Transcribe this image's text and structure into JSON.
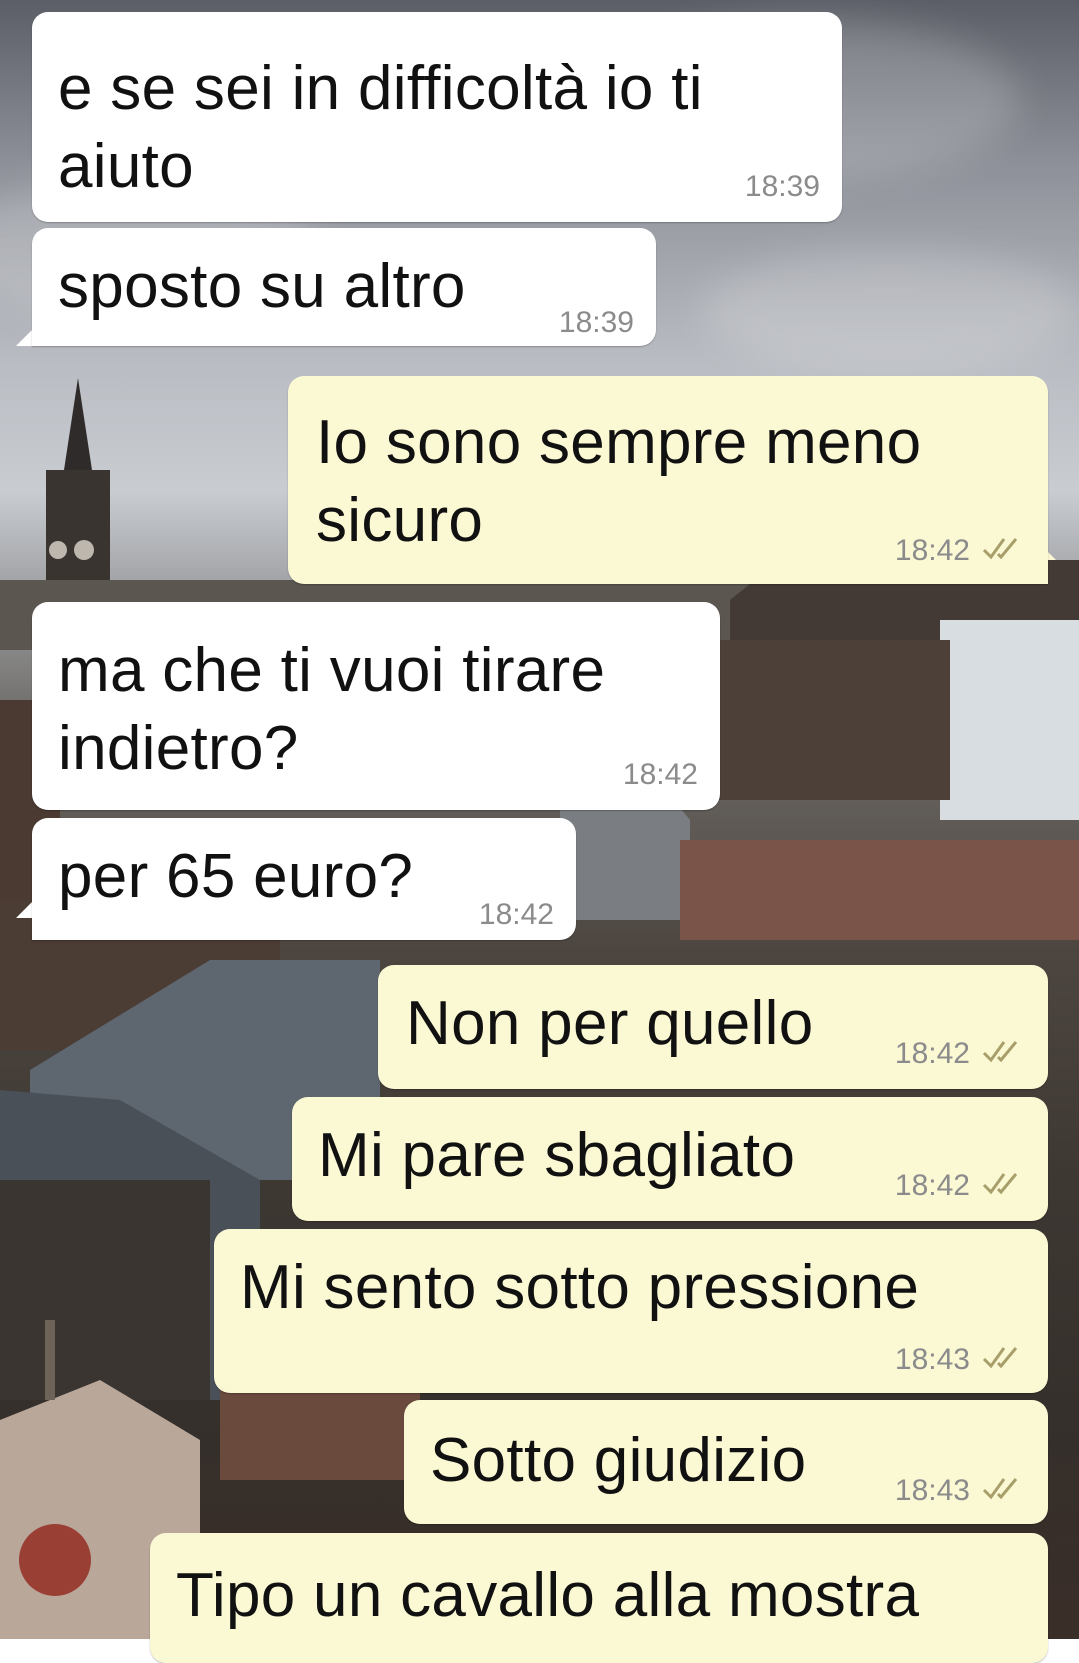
{
  "chat": {
    "messages": [
      {
        "direction": "in",
        "text": "e se sei in difficoltà io ti\naiuto",
        "time": "18:39"
      },
      {
        "direction": "in",
        "text": "sposto su altro",
        "time": "18:39"
      },
      {
        "direction": "out",
        "text": "Io sono sempre meno\nsicuro",
        "time": "18:42",
        "status": "read"
      },
      {
        "direction": "in",
        "text": "ma che ti vuoi tirare\nindietro?",
        "time": "18:42"
      },
      {
        "direction": "in",
        "text": "per 65 euro?",
        "time": "18:42"
      },
      {
        "direction": "out",
        "text": "Non per quello",
        "time": "18:42",
        "status": "read"
      },
      {
        "direction": "out",
        "text": "Mi pare sbagliato",
        "time": "18:42",
        "status": "read"
      },
      {
        "direction": "out",
        "text": "Mi sento sotto pressione",
        "time": "18:43",
        "status": "read"
      },
      {
        "direction": "out",
        "text": "Sotto giudizio",
        "time": "18:43",
        "status": "read"
      },
      {
        "direction": "out",
        "text": "Tipo un cavallo alla mostra",
        "time": "",
        "status": ""
      }
    ],
    "colors": {
      "incoming_bubble": "#ffffff",
      "outgoing_bubble": "#fbf8d4",
      "timestamp": "#8b8b8b",
      "read_ticks": "#a89e6a"
    },
    "icons": {
      "read_status": "double-check-icon"
    }
  }
}
